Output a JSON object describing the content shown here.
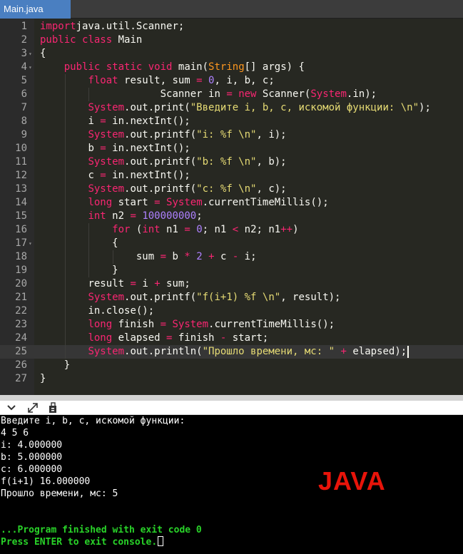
{
  "tab": {
    "title": "Main.java"
  },
  "editor": {
    "language": "java",
    "active_line": 25,
    "lines": [
      {
        "n": "1",
        "indent": 0,
        "tokens": [
          [
            "kw",
            "import"
          ],
          [
            "",
            "java.util.Scanner;"
          ]
        ]
      },
      {
        "n": "2",
        "indent": 0,
        "tokens": [
          [
            "kw",
            "public"
          ],
          [
            "",
            " "
          ],
          [
            "kw",
            "class"
          ],
          [
            "",
            " Main"
          ]
        ]
      },
      {
        "n": "3",
        "indent": 0,
        "fold": true,
        "tokens": [
          [
            "",
            "{"
          ]
        ]
      },
      {
        "n": "4",
        "indent": 4,
        "fold": true,
        "tokens": [
          [
            "kw",
            "public"
          ],
          [
            "",
            " "
          ],
          [
            "kw",
            "static"
          ],
          [
            "",
            " "
          ],
          [
            "kw",
            "void"
          ],
          [
            "",
            " main("
          ],
          [
            "cl",
            "String"
          ],
          [
            "",
            "[] args) {"
          ]
        ]
      },
      {
        "n": "5",
        "indent": 8,
        "tokens": [
          [
            "kw",
            "float"
          ],
          [
            "",
            " result, sum "
          ],
          [
            "op",
            "="
          ],
          [
            "",
            " "
          ],
          [
            "nu",
            "0"
          ],
          [
            "",
            ", i, b, c;"
          ]
        ]
      },
      {
        "n": "6",
        "indent": 12,
        "tokens": [
          [
            "",
            "        Scanner in "
          ],
          [
            "op",
            "="
          ],
          [
            "",
            " "
          ],
          [
            "kw",
            "new"
          ],
          [
            "",
            " Scanner("
          ],
          [
            "sy",
            "System"
          ],
          [
            "",
            ".in);"
          ]
        ]
      },
      {
        "n": "7",
        "indent": 8,
        "tokens": [
          [
            "sy",
            "System"
          ],
          [
            "",
            ".out.print("
          ],
          [
            "st",
            "\"Введите i, b, c, искомой функции: \\n\""
          ],
          [
            "",
            ");"
          ]
        ]
      },
      {
        "n": "8",
        "indent": 8,
        "tokens": [
          [
            "",
            "i "
          ],
          [
            "op",
            "="
          ],
          [
            "",
            " in.nextInt();"
          ]
        ]
      },
      {
        "n": "9",
        "indent": 8,
        "tokens": [
          [
            "sy",
            "System"
          ],
          [
            "",
            ".out.printf("
          ],
          [
            "st",
            "\"i: %f \\n\""
          ],
          [
            "",
            ", i);"
          ]
        ]
      },
      {
        "n": "10",
        "indent": 8,
        "tokens": [
          [
            "",
            "b "
          ],
          [
            "op",
            "="
          ],
          [
            "",
            " in.nextInt();"
          ]
        ]
      },
      {
        "n": "11",
        "indent": 8,
        "tokens": [
          [
            "sy",
            "System"
          ],
          [
            "",
            ".out.printf("
          ],
          [
            "st",
            "\"b: %f \\n\""
          ],
          [
            "",
            ", b);"
          ]
        ]
      },
      {
        "n": "12",
        "indent": 8,
        "tokens": [
          [
            "",
            "c "
          ],
          [
            "op",
            "="
          ],
          [
            "",
            " in.nextInt();"
          ]
        ]
      },
      {
        "n": "13",
        "indent": 8,
        "tokens": [
          [
            "sy",
            "System"
          ],
          [
            "",
            ".out.printf("
          ],
          [
            "st",
            "\"c: %f \\n\""
          ],
          [
            "",
            ", c);"
          ]
        ]
      },
      {
        "n": "14",
        "indent": 8,
        "tokens": [
          [
            "kw",
            "long"
          ],
          [
            "",
            " start "
          ],
          [
            "op",
            "="
          ],
          [
            "",
            " "
          ],
          [
            "sy",
            "System"
          ],
          [
            "",
            ".currentTimeMillis();"
          ]
        ]
      },
      {
        "n": "15",
        "indent": 8,
        "tokens": [
          [
            "kw",
            "int"
          ],
          [
            "",
            " n2 "
          ],
          [
            "op",
            "="
          ],
          [
            "",
            " "
          ],
          [
            "nu",
            "100000000"
          ],
          [
            "",
            ";"
          ]
        ]
      },
      {
        "n": "16",
        "indent": 12,
        "tokens": [
          [
            "kw",
            "for"
          ],
          [
            "",
            " ("
          ],
          [
            "kw",
            "int"
          ],
          [
            "",
            " n1 "
          ],
          [
            "op",
            "="
          ],
          [
            "",
            " "
          ],
          [
            "nu",
            "0"
          ],
          [
            "",
            "; n1 "
          ],
          [
            "op",
            "<"
          ],
          [
            "",
            " n2; n1"
          ],
          [
            "op",
            "++"
          ],
          [
            "",
            ")"
          ]
        ]
      },
      {
        "n": "17",
        "indent": 12,
        "fold": true,
        "tokens": [
          [
            "",
            "{"
          ]
        ]
      },
      {
        "n": "18",
        "indent": 16,
        "tokens": [
          [
            "",
            "sum "
          ],
          [
            "op",
            "="
          ],
          [
            "",
            " b "
          ],
          [
            "op",
            "*"
          ],
          [
            "",
            " "
          ],
          [
            "nu",
            "2"
          ],
          [
            "",
            " "
          ],
          [
            "op",
            "+"
          ],
          [
            "",
            " c "
          ],
          [
            "op",
            "-"
          ],
          [
            "",
            " i;"
          ]
        ]
      },
      {
        "n": "19",
        "indent": 12,
        "tokens": [
          [
            "",
            "}"
          ]
        ]
      },
      {
        "n": "20",
        "indent": 8,
        "tokens": [
          [
            "",
            "result "
          ],
          [
            "op",
            "="
          ],
          [
            "",
            " i "
          ],
          [
            "op",
            "+"
          ],
          [
            "",
            " sum;"
          ]
        ]
      },
      {
        "n": "21",
        "indent": 8,
        "tokens": [
          [
            "sy",
            "System"
          ],
          [
            "",
            ".out.printf("
          ],
          [
            "st",
            "\"f(i+1) %f \\n\""
          ],
          [
            "",
            ", result);"
          ]
        ]
      },
      {
        "n": "22",
        "indent": 8,
        "tokens": [
          [
            "",
            "in.close();"
          ]
        ]
      },
      {
        "n": "23",
        "indent": 8,
        "tokens": [
          [
            "kw",
            "long"
          ],
          [
            "",
            " finish "
          ],
          [
            "op",
            "="
          ],
          [
            "",
            " "
          ],
          [
            "sy",
            "System"
          ],
          [
            "",
            ".currentTimeMillis();"
          ]
        ]
      },
      {
        "n": "24",
        "indent": 8,
        "tokens": [
          [
            "kw",
            "long"
          ],
          [
            "",
            " elapsed "
          ],
          [
            "op",
            "="
          ],
          [
            "",
            " finish "
          ],
          [
            "op",
            "-"
          ],
          [
            "",
            " start;"
          ]
        ]
      },
      {
        "n": "25",
        "indent": 8,
        "tokens": [
          [
            "sy",
            "System"
          ],
          [
            "",
            ".out.println("
          ],
          [
            "st",
            "\"Прошло времени, мс: \""
          ],
          [
            "",
            " "
          ],
          [
            "op",
            "+"
          ],
          [
            "",
            " elapsed);"
          ]
        ]
      },
      {
        "n": "26",
        "indent": 4,
        "tokens": [
          [
            "",
            "}"
          ]
        ]
      },
      {
        "n": "27",
        "indent": 0,
        "tokens": [
          [
            "",
            "}"
          ]
        ]
      }
    ]
  },
  "toolbar": {
    "collapse_icon": "chevron-down-icon",
    "expand_icon": "expand-arrows-icon",
    "copy_icon": "copy-icon"
  },
  "console": {
    "lines": [
      {
        "text": "Введите i, b, c, искомой функции:",
        "style": "normal"
      },
      {
        "text": "4 5 6",
        "style": "normal"
      },
      {
        "text": "i: 4.000000",
        "style": "normal"
      },
      {
        "text": "b: 5.000000",
        "style": "normal"
      },
      {
        "text": "c: 6.000000",
        "style": "normal"
      },
      {
        "text": "f(i+1) 16.000000",
        "style": "normal"
      },
      {
        "text": "Прошло времени, мс: 5",
        "style": "normal"
      },
      {
        "text": "",
        "style": "normal"
      },
      {
        "text": "",
        "style": "normal"
      },
      {
        "text": "...Program finished with exit code 0",
        "style": "green"
      },
      {
        "text": "Press ENTER to exit console.",
        "style": "green",
        "cursor": true
      }
    ],
    "watermark": "JAVA",
    "watermark_color": "#e8140a"
  }
}
